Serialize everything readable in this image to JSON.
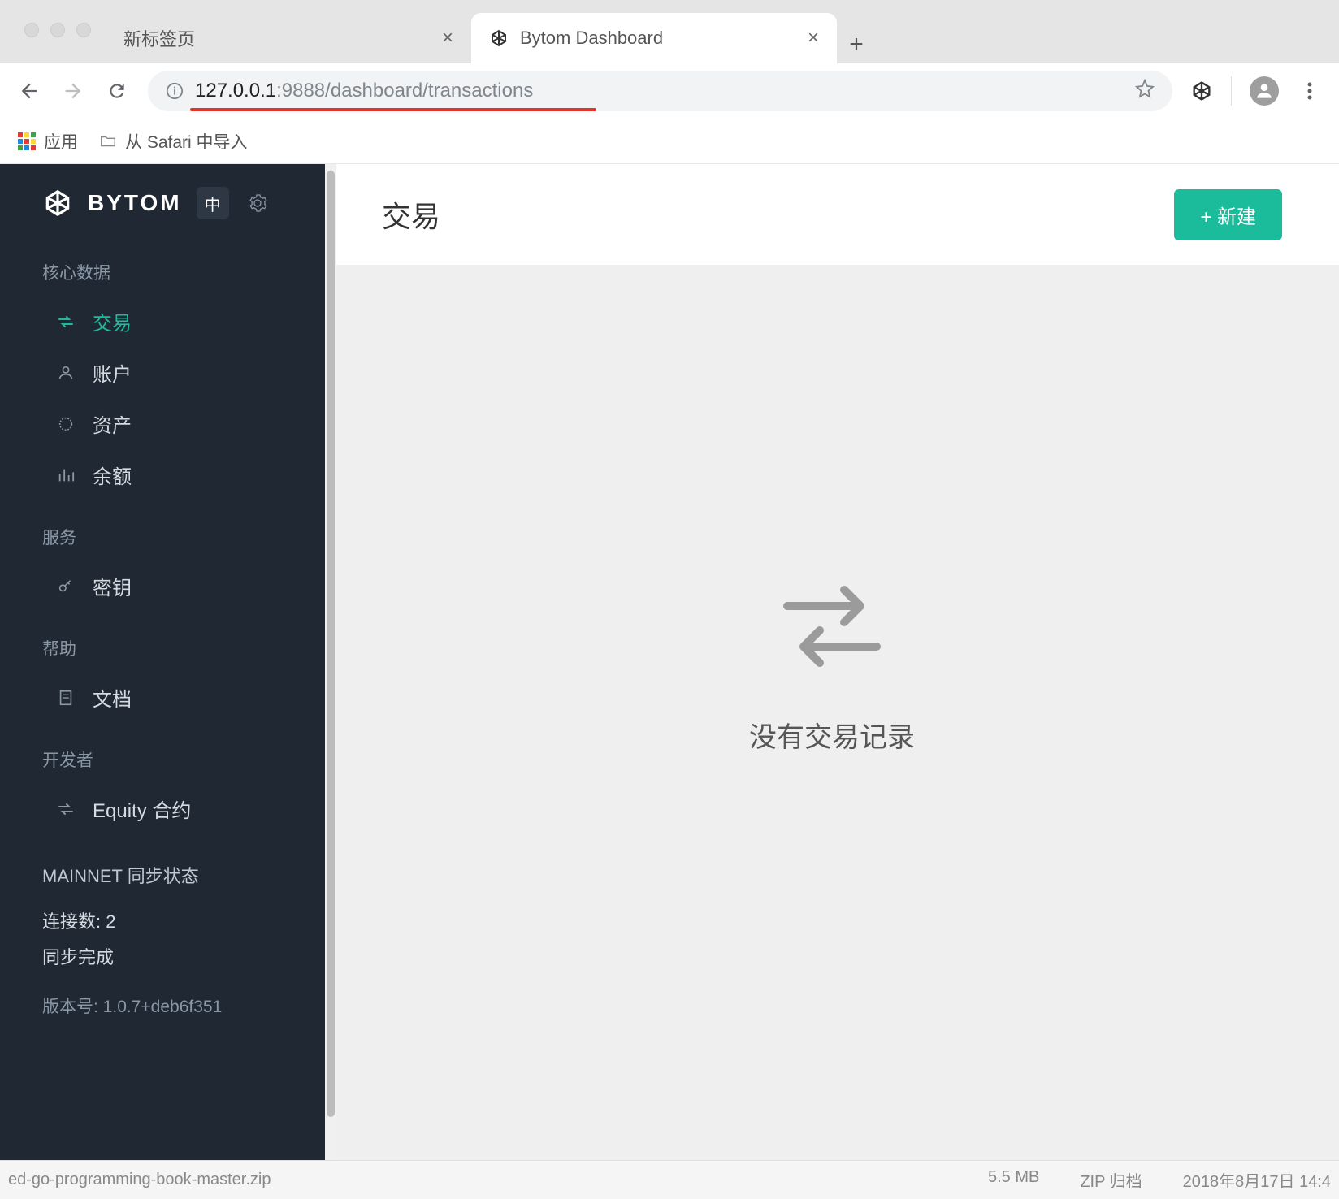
{
  "browser": {
    "tabs": [
      {
        "title": "新标签页",
        "active": false
      },
      {
        "title": "Bytom Dashboard",
        "active": true
      }
    ],
    "url_host": "127.0.0.1",
    "url_port": ":9888",
    "url_path": "/dashboard/transactions"
  },
  "bookmarks": {
    "apps_label": "应用",
    "items": [
      "从 Safari 中导入"
    ]
  },
  "sidebar": {
    "logo": "BYTOM",
    "lang": "中",
    "sections": [
      {
        "label": "核心数据",
        "items": [
          {
            "icon": "swap-icon",
            "label": "交易",
            "active": true
          },
          {
            "icon": "person-icon",
            "label": "账户",
            "active": false
          },
          {
            "icon": "circle-icon",
            "label": "资产",
            "active": false
          },
          {
            "icon": "chart-icon",
            "label": "余额",
            "active": false
          }
        ]
      },
      {
        "label": "服务",
        "items": [
          {
            "icon": "key-icon",
            "label": "密钥",
            "active": false
          }
        ]
      },
      {
        "label": "帮助",
        "items": [
          {
            "icon": "doc-icon",
            "label": "文档",
            "active": false
          }
        ]
      },
      {
        "label": "开发者",
        "items": [
          {
            "icon": "swap-icon",
            "label": "Equity 合约",
            "active": false
          }
        ]
      }
    ],
    "status": {
      "heading": "MAINNET 同步状态",
      "connections_label": "连接数:",
      "connections_value": "2",
      "sync_label": "同步完成",
      "version_label": "版本号:",
      "version_value": "1.0.7+deb6f351"
    }
  },
  "main": {
    "title": "交易",
    "new_button": "+ 新建",
    "empty_message": "没有交易记录"
  },
  "download_bar": {
    "left": "ed-go-programming-book-master.zip",
    "size": "5.5 MB",
    "type": "ZIP 归档",
    "date": "2018年8月17日 14:4"
  }
}
